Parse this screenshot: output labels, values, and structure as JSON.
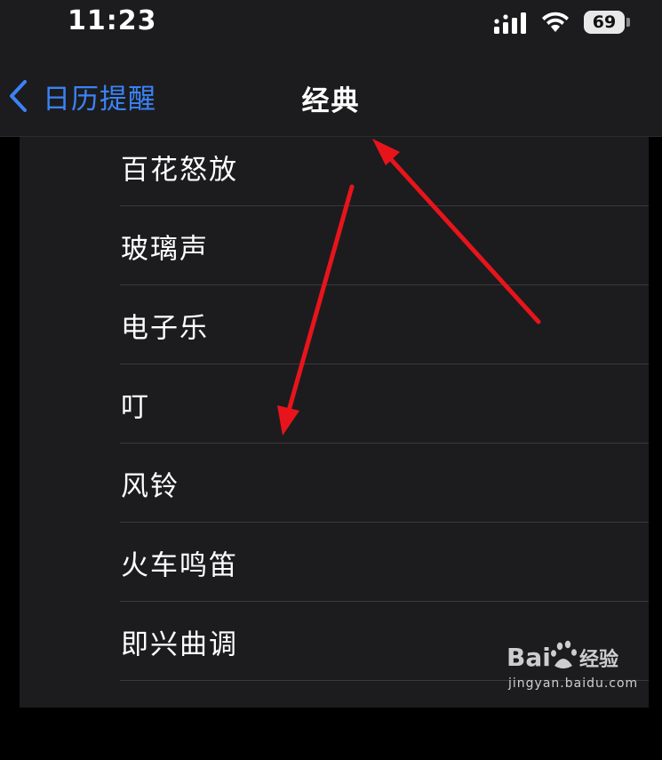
{
  "status_bar": {
    "time": "11:23",
    "battery_level": "69",
    "icons": [
      "cellular-signal-icon",
      "wifi-icon",
      "battery-icon"
    ]
  },
  "nav_bar": {
    "back_label": "日历提醒",
    "title": "经典",
    "accent_color": "#3b82f6"
  },
  "list": {
    "items": [
      {
        "label": "百花怒放"
      },
      {
        "label": "玻璃声"
      },
      {
        "label": "电子乐"
      },
      {
        "label": "叮"
      },
      {
        "label": "风铃"
      },
      {
        "label": "火车鸣笛"
      },
      {
        "label": "即兴曲调"
      }
    ]
  },
  "annotations": {
    "arrow_color": "#e8141c",
    "arrows": [
      "arrow-up-to-title",
      "arrow-down-to-list"
    ]
  },
  "watermark": {
    "brand": "Bai du 经验",
    "url": "jingyan.baidu.com"
  }
}
